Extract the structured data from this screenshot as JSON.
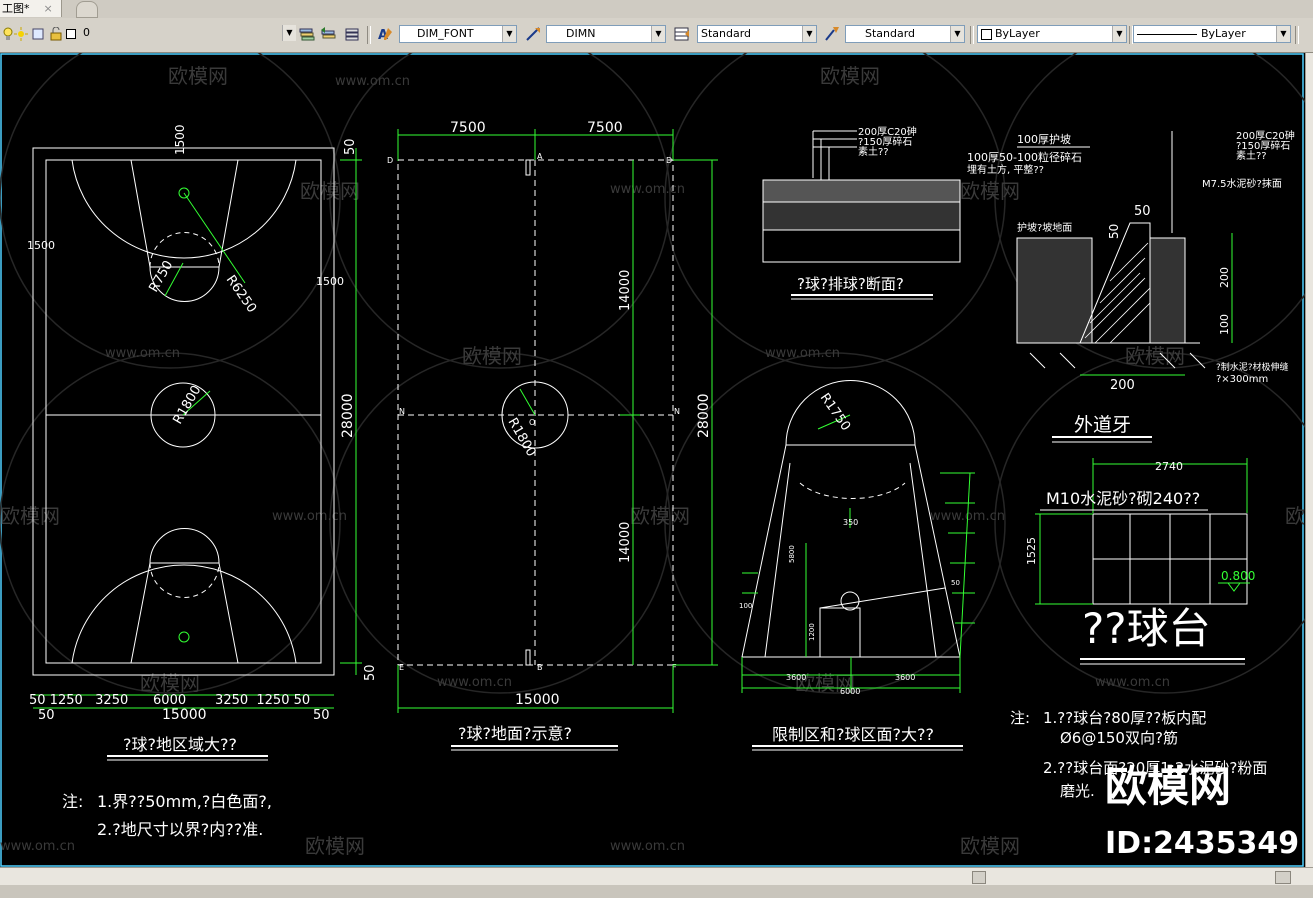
{
  "window": {
    "tab_title": "工图*",
    "tab_close": "×"
  },
  "toolbar": {
    "layer_value": "0",
    "dimfont_value": "DIM_FONT",
    "dimn_value": "DIMN",
    "textstyle_value": "Standard",
    "tablestyle_value": "Standard",
    "color_value": "ByLayer",
    "linetype_value": "ByLayer"
  },
  "watermark": {
    "site": "www.om.cn",
    "brand": "欧模网",
    "id_text": "ID:2435349"
  },
  "drawing": {
    "court_plan": {
      "title": "?球?地区域大??",
      "dims": {
        "top_1500": "1500",
        "left_1500": "1500",
        "right_1500": "1500",
        "r6250": "R6250",
        "r750": "R750",
        "r1800": "R1800",
        "d50_top": "50",
        "d28000": "28000",
        "d50_bottom": "50",
        "bottom_row": "50 1250   3250      6000       3250  1250 50",
        "total": "15000",
        "d50_l": "50",
        "d50_r": "50"
      },
      "notes": {
        "label": "注:",
        "line1": "1.界??50mm,?白色面?,",
        "line2": "2.?地尺寸以界?内??准."
      }
    },
    "ground_plan": {
      "title": "?球?地面?示意?",
      "dims": {
        "top_left": "7500",
        "top_right": "7500",
        "upper": "14000",
        "lower": "14000",
        "total_height": "28000",
        "bottom": "15000",
        "r1800": "R1800"
      },
      "corners": {
        "d": "D",
        "a": "A",
        "b": "B",
        "e": "E",
        "f": "F",
        "n": "N",
        "o": "O"
      }
    },
    "section": {
      "title": "?球?排球?断面?",
      "layers": [
        "200厚C20砷",
        "?150厚碎石",
        "素土??"
      ]
    },
    "curb": {
      "title": "外道牙",
      "labels": {
        "l1": "100厚护坡",
        "l2": "100厚50-100粒径碎石",
        "l3": "埋有土方, 平整??",
        "r1": "200厚C20砷",
        "r2": "?150厚碎石",
        "r3": "素土??",
        "m75": "M7.5水泥砂?抹面",
        "slope": "护坡?坡地面",
        "d50": "50",
        "d50b": "50",
        "d200": "200",
        "d100": "100",
        "d200b": "200",
        "bottom1": "?制水泥?材极伸缝",
        "bottom2": "?×300mm"
      }
    },
    "restricted": {
      "title": "限制区和?球区面?大??",
      "dims": {
        "r1750": "R1750",
        "d3600a": "3600",
        "d3600b": "3600",
        "d6000": "6000",
        "d5800": "5800",
        "d1200": "1200",
        "d350": "350",
        "d100": "100",
        "d50": "50"
      }
    },
    "table": {
      "title": "??球台",
      "label": "M10水泥砂?砌240??",
      "w": "2740",
      "h": "1525",
      "elev": "0.800",
      "notes": {
        "label": "注:",
        "line1": "1.??球台?80厚??板内配",
        "line2": "Ø6@150双向?筋",
        "line3": "2.??球台面?20厚1:2水泥砂?粉面",
        "line4": "磨光."
      }
    }
  }
}
